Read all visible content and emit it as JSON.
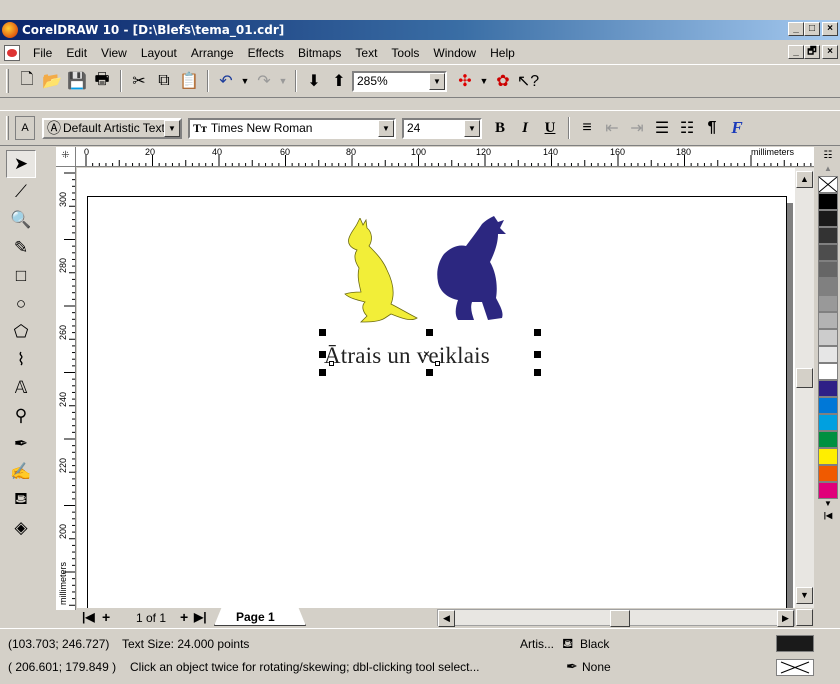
{
  "window": {
    "title": "CorelDRAW 10 - [D:\\Blefs\\tema_01.cdr]",
    "min_label": "_",
    "max_label": "□",
    "close_label": "×",
    "doc_min_label": "_",
    "doc_restore_label": "🗗",
    "doc_close_label": "×"
  },
  "menu": [
    "File",
    "Edit",
    "View",
    "Layout",
    "Arrange",
    "Effects",
    "Bitmaps",
    "Text",
    "Tools",
    "Window",
    "Help"
  ],
  "standard_toolbar": {
    "zoom_value": "285%"
  },
  "property_bar": {
    "style_value": "Default Artistic Text *",
    "font_value": "Times New Roman",
    "size_value": "24",
    "bold_label": "B",
    "italic_label": "I",
    "underline_label": "U",
    "pilcrow_label": "¶",
    "format_label": "F"
  },
  "rulers": {
    "unit": "millimeters",
    "h_ticks": [
      "0",
      "20",
      "40",
      "60",
      "80",
      "100",
      "120",
      "140",
      "160",
      "180"
    ],
    "v_ticks": [
      "300",
      "280",
      "260",
      "240",
      "220",
      "200"
    ]
  },
  "canvas": {
    "artistic_text": "Ātrais un veiklais"
  },
  "page_nav": {
    "page_count": "1 of 1",
    "page_tab": "Page 1"
  },
  "status": {
    "line1_coords": "(103.703; 246.727)",
    "line1_info": "Text Size: 24.000 points",
    "line1_obj": "Artis...",
    "line1_fill": "Black",
    "line2_coords": "( 206.601; 179.849 )",
    "line2_info": "Click an object twice for rotating/skewing; dbl-clicking tool select...",
    "line2_outline": "None"
  },
  "palette_colors": [
    "#ffffff",
    "#000000",
    "#1a1a1a",
    "#333333",
    "#4d4d4d",
    "#666666",
    "#808080",
    "#999999",
    "#b3b3b3",
    "#cccccc",
    "#e6e6e6",
    "#ffffff",
    "#2e1f86",
    "#0078d7",
    "#00a0e0",
    "#009040",
    "#ffee00",
    "#f05a00",
    "#e0007a"
  ],
  "colors": {
    "kangaroo": "#f2ee38",
    "gorilla": "#2c2780",
    "accent": "#0a246a"
  }
}
